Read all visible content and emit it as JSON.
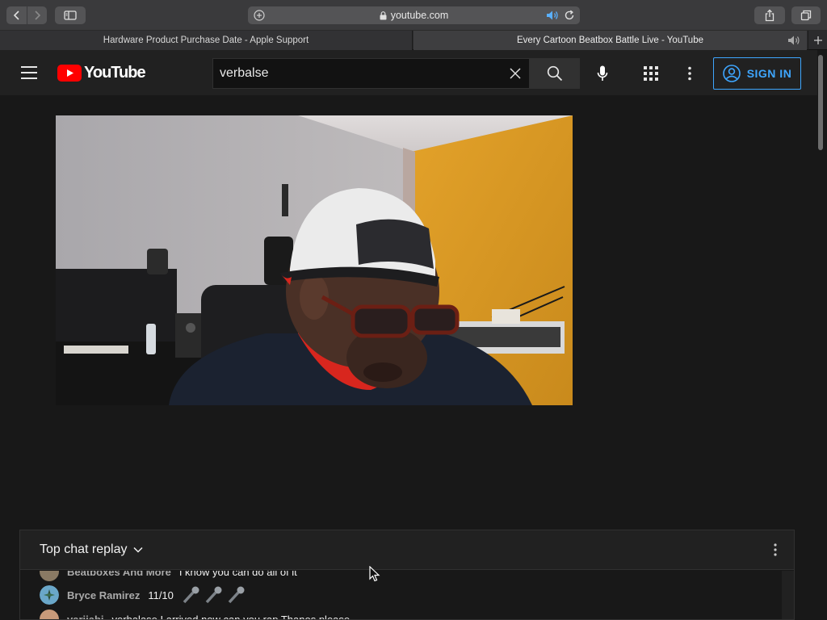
{
  "browser": {
    "url": "youtube.com",
    "tabs": [
      {
        "title": "Hardware Product Purchase Date - Apple Support",
        "active": false
      },
      {
        "title": "Every Cartoon Beatbox Battle Live - YouTube",
        "active": true
      }
    ]
  },
  "youtube": {
    "logo_text": "YouTube",
    "search": {
      "value": "verbalse"
    },
    "sign_in_label": "SIGN IN",
    "colors": {
      "accent": "#3ea6ff",
      "brand_red": "#ff0000",
      "background": "#181818",
      "header": "#212121"
    }
  },
  "video": {
    "scene": "man in white backwards cap and glasses beatboxing in a room with yellow wall"
  },
  "chat": {
    "title": "Top chat replay",
    "messages": [
      {
        "author": "Beatboxes And More",
        "text": "I know you can do all of it"
      },
      {
        "author": "Bryce Ramirez",
        "text": "11/10",
        "emojis": [
          "🎤",
          "🎤",
          "🎤"
        ]
      },
      {
        "author": "varijabi",
        "text": "verbalase I arrived now can you rap Thanos please"
      }
    ]
  }
}
